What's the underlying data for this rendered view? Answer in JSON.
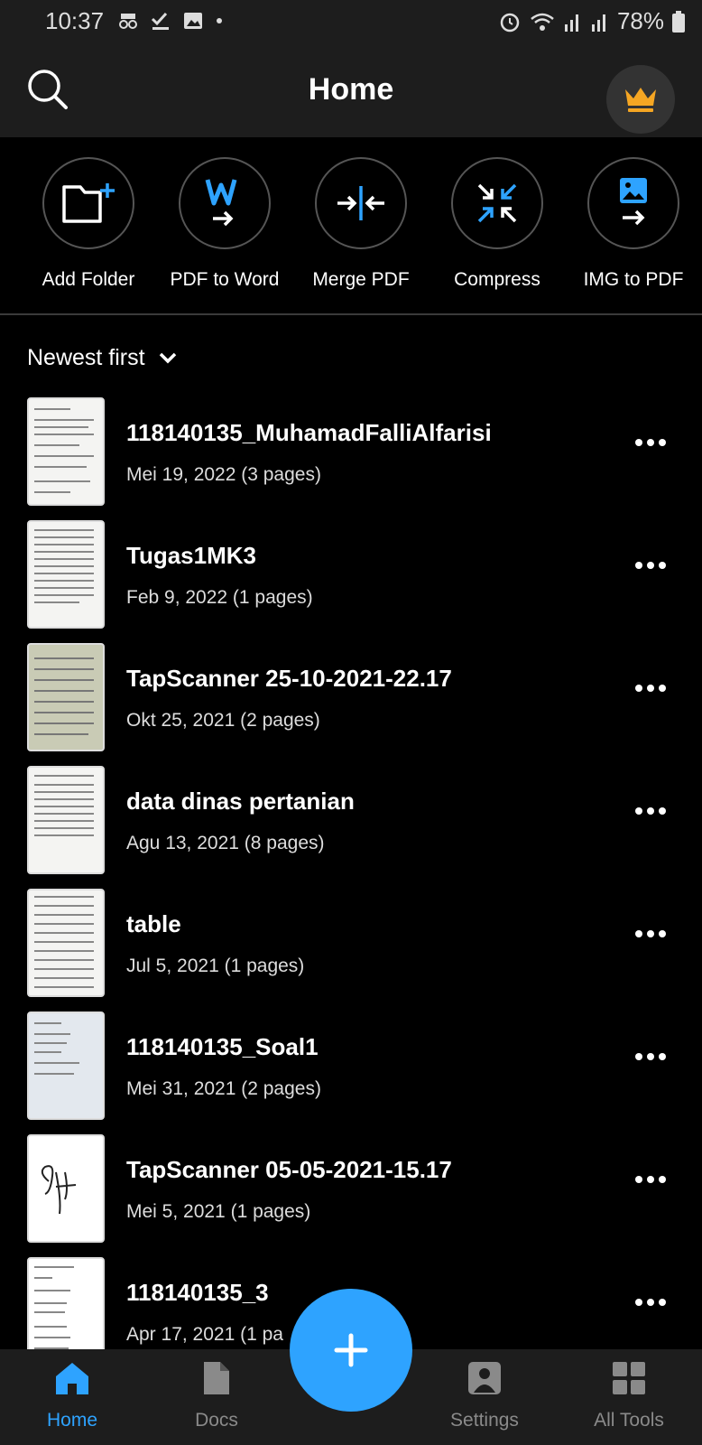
{
  "status_bar": {
    "time": "10:37",
    "battery": "78%"
  },
  "header": {
    "title": "Home"
  },
  "tools": [
    {
      "label": "Add Folder",
      "icon": "add-folder-icon"
    },
    {
      "label": "PDF to Word",
      "icon": "pdf-to-word-icon"
    },
    {
      "label": "Merge PDF",
      "icon": "merge-icon"
    },
    {
      "label": "Compress",
      "icon": "compress-icon"
    },
    {
      "label": "IMG to PDF",
      "icon": "img-to-pdf-icon"
    }
  ],
  "sort": {
    "label": "Newest first"
  },
  "documents": [
    {
      "name": "118140135_MuhamadFalliAlfarisi",
      "meta": "Mei 19, 2022 (3 pages)"
    },
    {
      "name": "Tugas1MK3",
      "meta": "Feb 9, 2022 (1 pages)"
    },
    {
      "name": "TapScanner 25-10-2021-22.17",
      "meta": "Okt 25, 2021 (2 pages)"
    },
    {
      "name": "data dinas pertanian",
      "meta": "Agu 13, 2021 (8 pages)"
    },
    {
      "name": "table",
      "meta": "Jul 5, 2021 (1 pages)"
    },
    {
      "name": "118140135_Soal1",
      "meta": "Mei 31, 2021 (2 pages)"
    },
    {
      "name": "TapScanner 05-05-2021-15.17",
      "meta": "Mei 5, 2021 (1 pages)"
    },
    {
      "name": "118140135_3",
      "meta": "Apr 17, 2021 (1 pa"
    }
  ],
  "bottom_nav": {
    "home": "Home",
    "docs": "Docs",
    "settings": "Settings",
    "all_tools": "All Tools"
  },
  "colors": {
    "accent": "#2ea3ff",
    "crown": "#f5a623",
    "background": "#000000",
    "bar": "#1d1d1d"
  }
}
